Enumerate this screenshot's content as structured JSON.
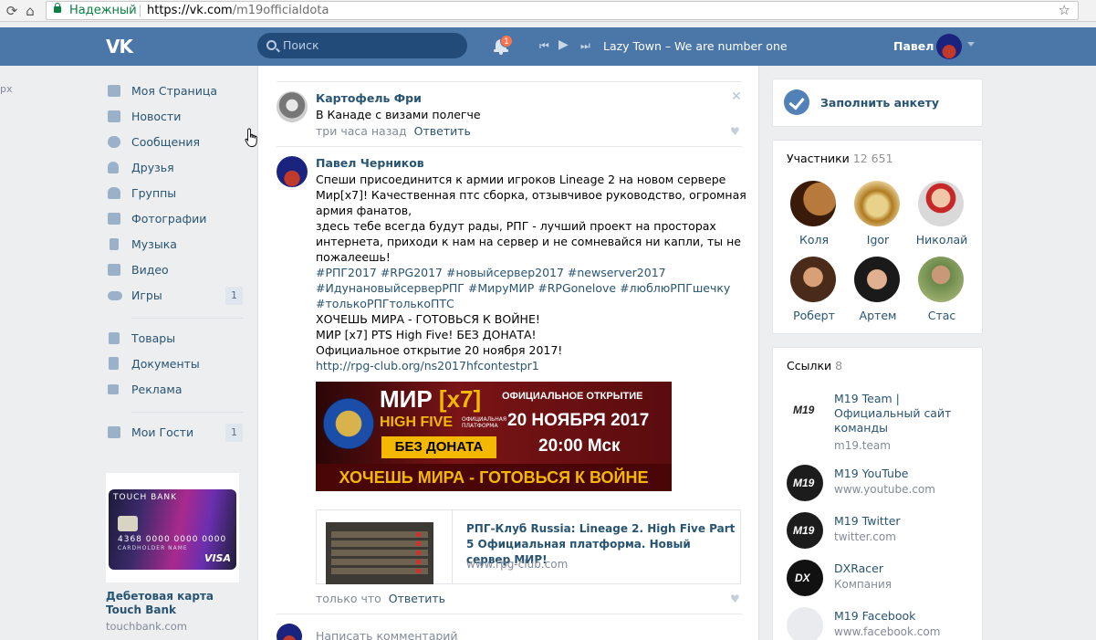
{
  "browser": {
    "secure_label": "Надежный",
    "url_host": "https://vk.com",
    "url_path": "/m19officialdota"
  },
  "header": {
    "search_placeholder": "Поиск",
    "notifications_count": "1",
    "track": "Lazy Town – We are number one",
    "user_name": "Павел"
  },
  "left_edge": "px",
  "nav": {
    "items": [
      {
        "label": "Моя Страница",
        "icon": "home-icon"
      },
      {
        "label": "Новости",
        "icon": "news-icon"
      },
      {
        "label": "Сообщения",
        "icon": "messages-icon"
      },
      {
        "label": "Друзья",
        "icon": "friends-icon"
      },
      {
        "label": "Группы",
        "icon": "groups-icon"
      },
      {
        "label": "Фотографии",
        "icon": "camera-icon"
      },
      {
        "label": "Музыка",
        "icon": "music-icon"
      },
      {
        "label": "Видео",
        "icon": "video-icon"
      },
      {
        "label": "Игры",
        "icon": "gamepad-icon",
        "count": "1"
      },
      {
        "label": "Товары",
        "icon": "bag-icon"
      },
      {
        "label": "Документы",
        "icon": "document-icon"
      },
      {
        "label": "Реклама",
        "icon": "megaphone-icon"
      },
      {
        "label": "Мои Гости",
        "icon": "grid-icon",
        "count": "1"
      }
    ]
  },
  "ad": {
    "card_brand": "TOUCH BANK",
    "card_number": "4368 0000 0000 0000",
    "card_holder": "CARDHOLDER NAME",
    "card_network": "VISA",
    "title": "Дебетовая карта Touch Bank",
    "domain": "touchbank.com"
  },
  "feed": {
    "comment1": {
      "author": "Картофель Фри",
      "text": "В Канаде с визами полегче",
      "time": "три часа назад",
      "reply": "Ответить"
    },
    "post": {
      "author": "Павел Черников",
      "lines": [
        "Спеши присоединится к армии игроков Lineage 2 на новом сервере",
        "Мир[x7]! Качественная птс сборка, отзывчивое руководство, огромная",
        "армия фанатов,",
        "здесь тебе всегда будут рады, РПГ - лучший проект на просторах",
        "интернета, приходи к нам на сервер и не сомневайся ни капли, ты не",
        "пожалеешь!"
      ],
      "tags1": "#РПГ2017 #RPG2017 #новыйсервер2017 #newserver2017",
      "tags2": "#ИдунановыйсерверРПГ #МируМИР #RPGonelove #люблюРПГшечку",
      "tags3": "#толькоРПГтолькоПТС",
      "line7": "ХОЧЕШЬ МИРА - ГОТОВЬСЯ К ВОЙНЕ!",
      "line8": "МИР [x7] PTS High Five! БЕЗ ДОНАТА!",
      "line9": "Официальное открытие 20 ноября 2017!",
      "link": "http://rpg-club.org/ns2017hfcontestpr1",
      "banner": {
        "mir": "МИР",
        "x7": "[x7]",
        "high_five": "HIGH FIVE",
        "platform": "ОФИЦИАЛЬНАЯ ПЛАТФОРМА",
        "no_donate": "БЕЗ ДОНАТА",
        "opening": "ОФИЦИАЛЬНОЕ ОТКРЫТИЕ",
        "date": "20 НОЯБРЯ 2017",
        "time": "20:00 Мск",
        "slogan": "ХОЧЕШЬ МИРА - ГОТОВЬСЯ К ВОЙНЕ"
      },
      "share_title": "РПГ-Клуб Russia: Lineage 2. High Five Part 5 Официальная платформа. Новый сервер МИР!",
      "share_domain": "www.rpg-club.com",
      "time": "только что",
      "reply": "Ответить"
    },
    "comment_placeholder": "Написать комментарий"
  },
  "right": {
    "fill_profile": "Заполнить анкету",
    "members_title": "Участники",
    "members_count": "12 651",
    "members": [
      "Коля",
      "Igor",
      "Николай",
      "Роберт",
      "Артем",
      "Стас"
    ],
    "links_title": "Ссылки",
    "links_count": "8",
    "links": [
      {
        "title": "M19 Team | Официальный сайт команды",
        "sub": "m19.team"
      },
      {
        "title": "M19 YouTube",
        "sub": "www.youtube.com"
      },
      {
        "title": "M19 Twitter",
        "sub": "twitter.com"
      },
      {
        "title": "DXRacer",
        "sub": "Компания"
      },
      {
        "title": "M19 Facebook",
        "sub": "www.facebook.com"
      }
    ],
    "logo_text": "M19",
    "dx_text": "DX"
  }
}
